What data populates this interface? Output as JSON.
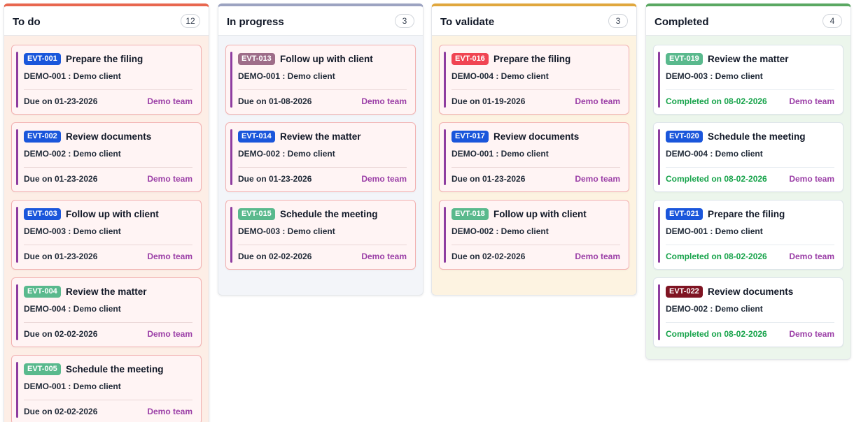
{
  "colors": {
    "badge_blue": "#1a56db",
    "badge_green": "#59b98d",
    "badge_mauve": "#9e6d89",
    "badge_red": "#f04452",
    "badge_darkred": "#7f1422",
    "accent_purple": "#8e3da0",
    "team_purple": "#9b3fa7",
    "completed_green": "#16a34a"
  },
  "columns": [
    {
      "title": "To do",
      "count": "12",
      "top_color": "#e8674f",
      "bg": "#fdeee6",
      "cards": [
        {
          "id": "EVT-001",
          "badge_color": "#1a56db",
          "title": "Prepare the filing",
          "client": "DEMO-001 : Demo client",
          "due": "Due on 01-23-2026",
          "team": "Demo team"
        },
        {
          "id": "EVT-002",
          "badge_color": "#1a56db",
          "title": "Review documents",
          "client": "DEMO-002 : Demo client",
          "due": "Due on 01-23-2026",
          "team": "Demo team"
        },
        {
          "id": "EVT-003",
          "badge_color": "#1a56db",
          "title": "Follow up with client",
          "client": "DEMO-003 : Demo client",
          "due": "Due on 01-23-2026",
          "team": "Demo team"
        },
        {
          "id": "EVT-004",
          "badge_color": "#59b98d",
          "title": "Review the matter",
          "client": "DEMO-004 : Demo client",
          "due": "Due on 02-02-2026",
          "team": "Demo team"
        },
        {
          "id": "EVT-005",
          "badge_color": "#59b98d",
          "title": "Schedule the meeting",
          "client": "DEMO-001 : Demo client",
          "due": "Due on 02-02-2026",
          "team": "Demo team"
        }
      ]
    },
    {
      "title": "In progress",
      "count": "3",
      "top_color": "#9ca3c1",
      "bg": "#f3f5f9",
      "cards": [
        {
          "id": "EVT-013",
          "badge_color": "#9e6d89",
          "title": "Follow up with client",
          "client": "DEMO-001 : Demo client",
          "due": "Due on 01-08-2026",
          "team": "Demo team"
        },
        {
          "id": "EVT-014",
          "badge_color": "#1a56db",
          "title": "Review the matter",
          "client": "DEMO-002 : Demo client",
          "due": "Due on 01-23-2026",
          "team": "Demo team"
        },
        {
          "id": "EVT-015",
          "badge_color": "#59b98d",
          "title": "Schedule the meeting",
          "client": "DEMO-003 : Demo client",
          "due": "Due on 02-02-2026",
          "team": "Demo team"
        }
      ]
    },
    {
      "title": "To validate",
      "count": "3",
      "top_color": "#e0a73d",
      "bg": "#fdf3e1",
      "cards": [
        {
          "id": "EVT-016",
          "badge_color": "#f04452",
          "title": "Prepare the filing",
          "client": "DEMO-004 : Demo client",
          "due": "Due on 01-19-2026",
          "team": "Demo team"
        },
        {
          "id": "EVT-017",
          "badge_color": "#1a56db",
          "title": "Review documents",
          "client": "DEMO-001 : Demo client",
          "due": "Due on 01-23-2026",
          "team": "Demo team"
        },
        {
          "id": "EVT-018",
          "badge_color": "#59b98d",
          "title": "Follow up with client",
          "client": "DEMO-002 : Demo client",
          "due": "Due on 02-02-2026",
          "team": "Demo team"
        }
      ]
    },
    {
      "title": "Completed",
      "count": "4",
      "top_color": "#5aa862",
      "bg": "#ecf6ec",
      "cards": [
        {
          "id": "EVT-019",
          "badge_color": "#59b98d",
          "title": "Review the matter",
          "client": "DEMO-003 : Demo client",
          "due": "Completed on 08-02-2026",
          "team": "Demo team",
          "done": true
        },
        {
          "id": "EVT-020",
          "badge_color": "#1a56db",
          "title": "Schedule the meeting",
          "client": "DEMO-004 : Demo client",
          "due": "Completed on 08-02-2026",
          "team": "Demo team",
          "done": true
        },
        {
          "id": "EVT-021",
          "badge_color": "#1a56db",
          "title": "Prepare the filing",
          "client": "DEMO-001 : Demo client",
          "due": "Completed on 08-02-2026",
          "team": "Demo team",
          "done": true
        },
        {
          "id": "EVT-022",
          "badge_color": "#7f1422",
          "title": "Review documents",
          "client": "DEMO-002 : Demo client",
          "due": "Completed on 08-02-2026",
          "team": "Demo team",
          "done": true
        }
      ]
    }
  ]
}
